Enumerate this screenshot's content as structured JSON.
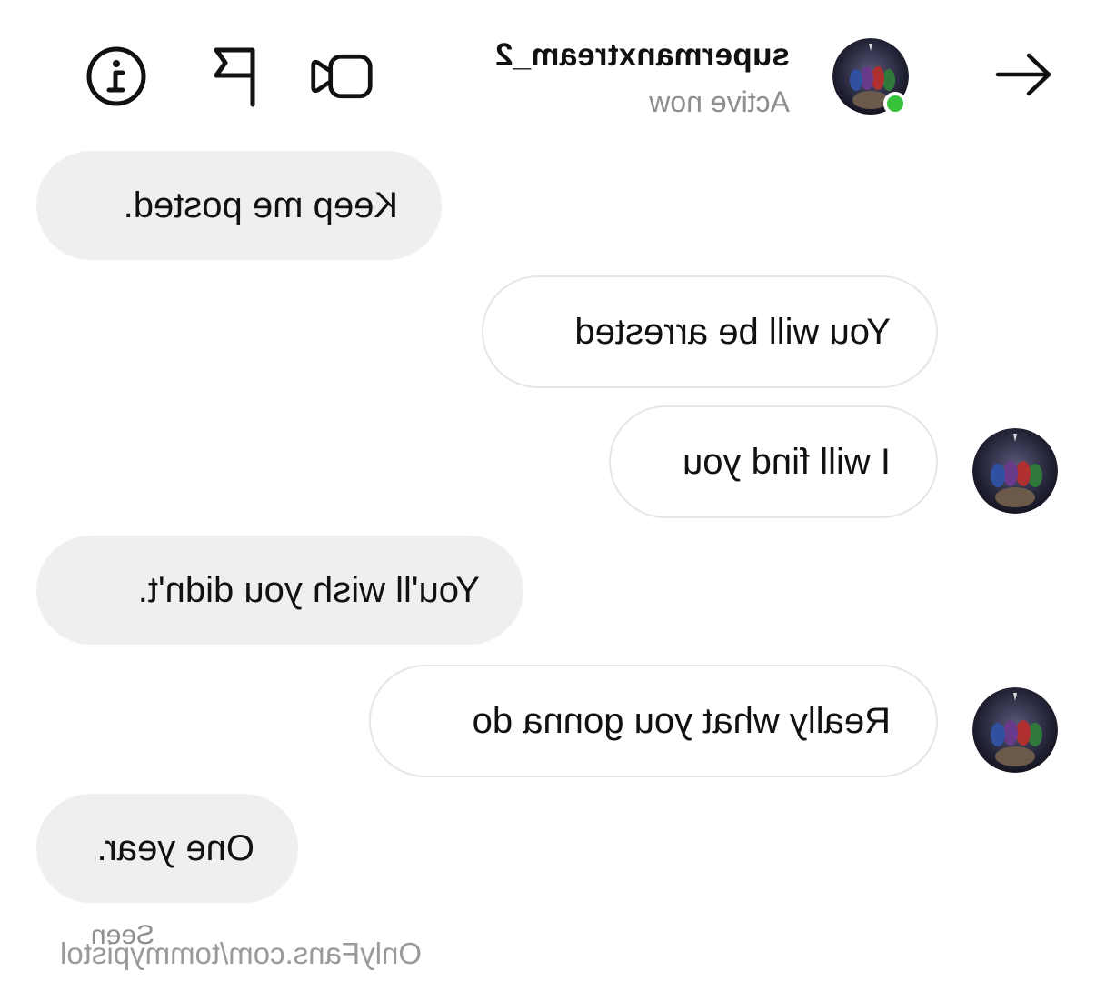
{
  "header": {
    "back_icon": "arrow-left-icon",
    "username": "supermanxtream_2",
    "status": "Active now",
    "status_color": "#37c23a",
    "video_icon": "video-camera-icon",
    "flag_icon": "flag-icon",
    "info_icon": "info-icon"
  },
  "messages": [
    {
      "from": "self",
      "text": "Keep me posted."
    },
    {
      "from": "contact",
      "text": "You will be arrested"
    },
    {
      "from": "contact",
      "text": "I will find you"
    },
    {
      "from": "self",
      "text": "You'll wish you didn't."
    },
    {
      "from": "contact",
      "text": "Really what you gonna do"
    },
    {
      "from": "self",
      "text": "One year."
    }
  ],
  "seen_label": "Seen",
  "watermark": "OnlyFans.com/tommypistol",
  "colors": {
    "self_bubble": "#efefef",
    "contact_bubble": "#ffffff",
    "muted_text": "#8e8e8e"
  }
}
